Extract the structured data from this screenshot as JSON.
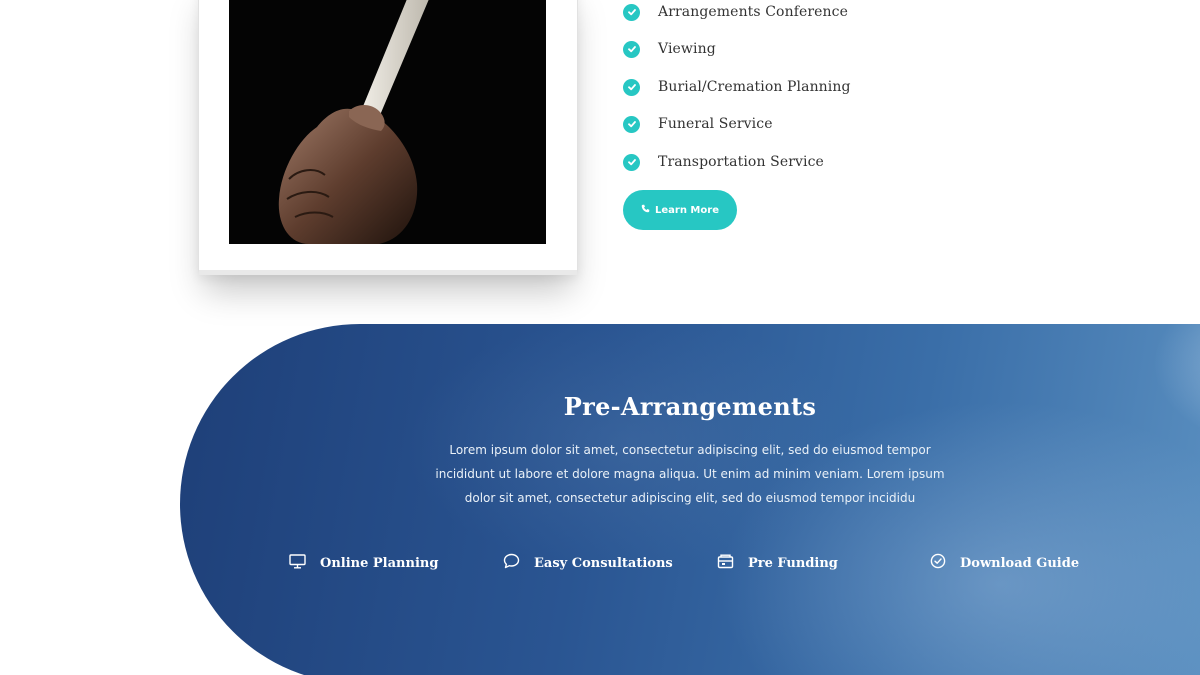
{
  "services": {
    "items": [
      "Arrangements Conference",
      "Viewing",
      "Burial/Cremation Planning",
      "Funeral Service",
      "Transportation Service"
    ],
    "cta_label": "Learn More",
    "cta_icon": "phone-icon"
  },
  "pre_arrangements": {
    "title": "Pre-Arrangements",
    "text": "Lorem ipsum dolor sit amet, consectetur adipiscing elit, sed do eiusmod tempor incididunt ut labore et dolore magna aliqua. Ut enim ad minim veniam. Lorem ipsum dolor sit amet, consectetur adipiscing elit, sed do eiusmod tempor incididu",
    "features": [
      {
        "label": "Online Planning",
        "icon": "monitor-icon"
      },
      {
        "label": "Easy Consultations",
        "icon": "chat-bubble-icon"
      },
      {
        "label": "Pre Funding",
        "icon": "wallet-icon"
      },
      {
        "label": "Download Guide",
        "icon": "check-circle-icon"
      }
    ]
  },
  "colors": {
    "accent": "#27c7c3",
    "section_blue": "#2a5592",
    "text_dark": "#333333"
  }
}
